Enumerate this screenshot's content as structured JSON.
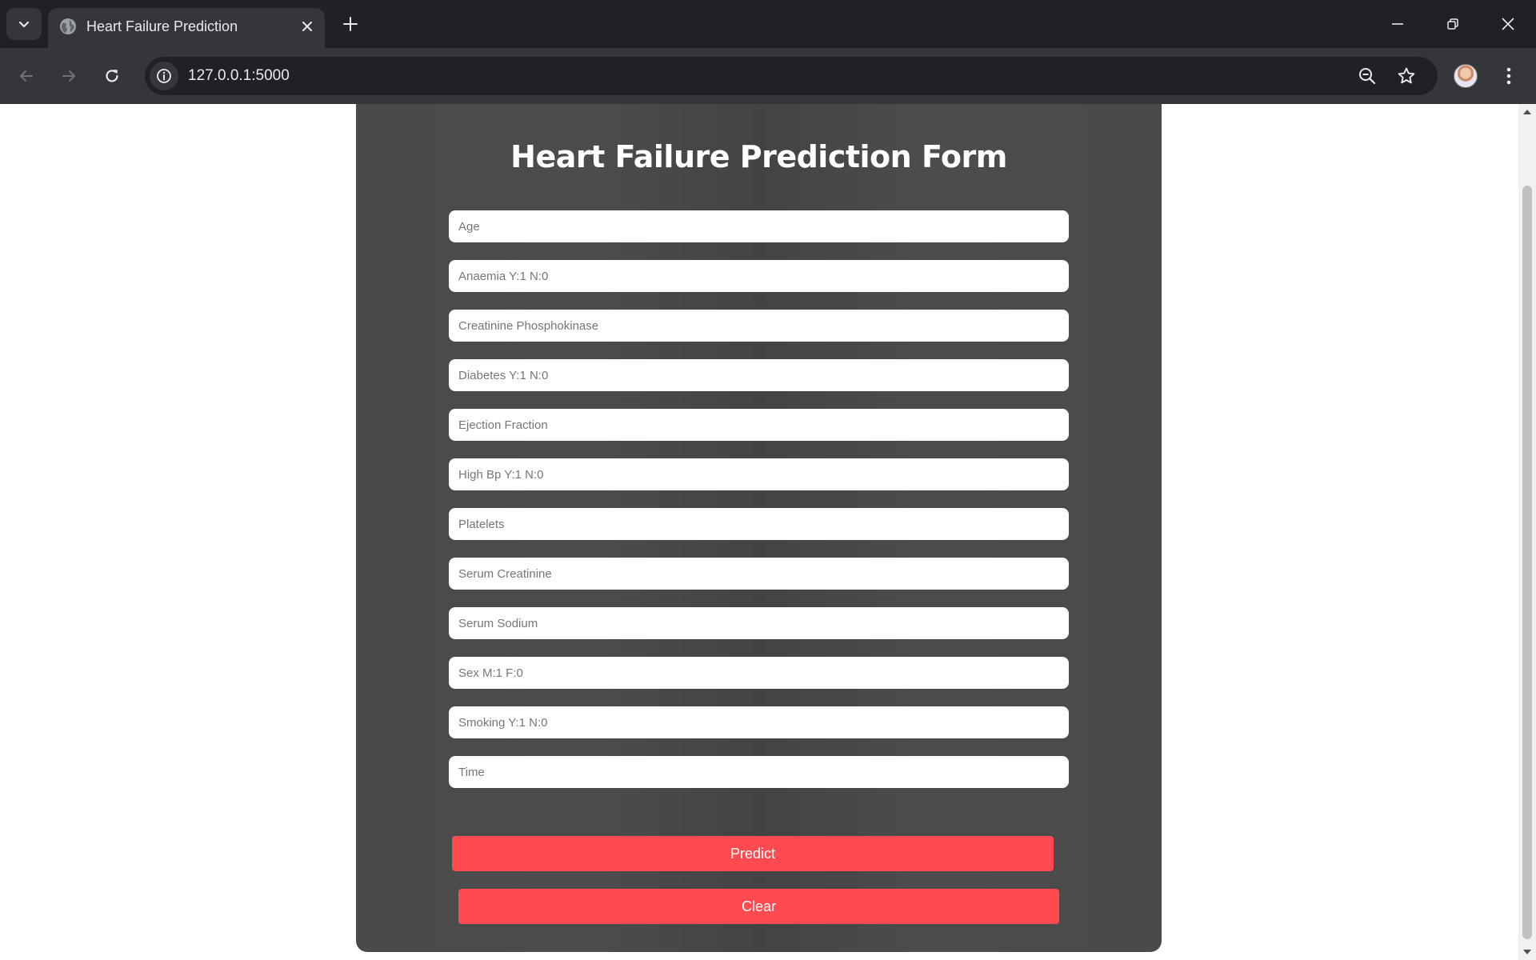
{
  "browser": {
    "tab_title": "Heart Failure Prediction",
    "url": "127.0.0.1:5000"
  },
  "form": {
    "title": "Heart Failure Prediction Form",
    "fields": [
      {
        "placeholder": "Age",
        "value": ""
      },
      {
        "placeholder": "Anaemia Y:1 N:0",
        "value": ""
      },
      {
        "placeholder": "Creatinine Phosphokinase",
        "value": ""
      },
      {
        "placeholder": "Diabetes Y:1 N:0",
        "value": ""
      },
      {
        "placeholder": "Ejection Fraction",
        "value": ""
      },
      {
        "placeholder": "High Bp Y:1 N:0",
        "value": ""
      },
      {
        "placeholder": "Platelets",
        "value": ""
      },
      {
        "placeholder": "Serum Creatinine",
        "value": ""
      },
      {
        "placeholder": "Serum Sodium",
        "value": ""
      },
      {
        "placeholder": "Sex M:1 F:0",
        "value": ""
      },
      {
        "placeholder": "Smoking Y:1 N:0",
        "value": ""
      },
      {
        "placeholder": "Time",
        "value": ""
      }
    ],
    "predict_label": "Predict",
    "clear_label": "Clear"
  },
  "colors": {
    "accent": "#ff4a4f",
    "card": "#4a4a4a",
    "chrome_dark": "#202124",
    "chrome_toolbar": "#35363a"
  },
  "icons": [
    "tab-search-icon",
    "globe-icon",
    "close-icon",
    "plus-icon",
    "minimize-icon",
    "restore-icon",
    "back-arrow-icon",
    "forward-arrow-icon",
    "reload-icon",
    "info-icon",
    "zoom-out-icon",
    "star-icon",
    "kebab-menu-icon"
  ]
}
